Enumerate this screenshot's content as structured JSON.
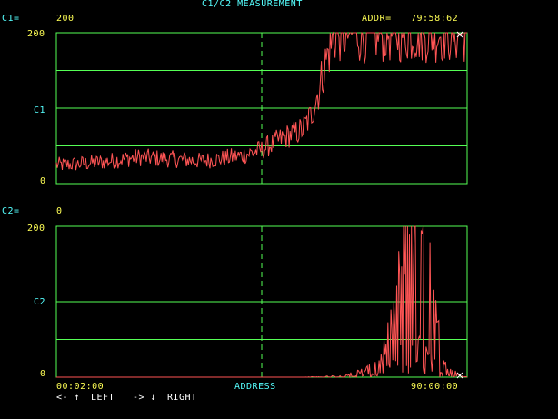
{
  "header": {
    "title": "C1/C2 MEASUREMENT"
  },
  "readouts": {
    "c1_label": "C1=",
    "c1_value": "200",
    "c2_label": "C2=",
    "c2_value": "0",
    "addr_label": "ADDR=",
    "addr_value": "79:58:62"
  },
  "upper_plot": {
    "ymax": "200",
    "ymid": "C1",
    "ymin": "0"
  },
  "lower_plot": {
    "ymax": "200",
    "ymid": "C2",
    "ymin": "0"
  },
  "x_axis": {
    "start": "00:02:00",
    "label": "ADDRESS",
    "end": "90:00:00"
  },
  "help": {
    "left_keys": "<- ↑",
    "left_label": "LEFT",
    "right_keys": "-> ↓",
    "right_label": "RIGHT"
  },
  "colors": {
    "grid": "#55ff55",
    "trace": "#ff5555",
    "label": "#55ffff",
    "value": "#ffff55"
  },
  "chart_data": [
    {
      "type": "line",
      "ylabel": "C1",
      "xlabel": "ADDRESS",
      "x_range": [
        "00:02:00",
        "90:00:00"
      ],
      "ylim": [
        0,
        200
      ],
      "cursor_x": "79:58:62",
      "series": [
        {
          "x_fraction": [
            0.02,
            0.1,
            0.2,
            0.3,
            0.35,
            0.4,
            0.45,
            0.5,
            0.55,
            0.58,
            0.6,
            0.62,
            0.63,
            0.64,
            0.65,
            0.66,
            0.67,
            0.68,
            0.7,
            0.75,
            1.0
          ],
          "values": [
            25,
            28,
            35,
            32,
            30,
            33,
            37,
            45,
            60,
            67,
            72,
            90,
            110,
            125,
            150,
            170,
            185,
            200,
            200,
            200,
            200
          ]
        }
      ]
    },
    {
      "type": "line",
      "ylabel": "C2",
      "xlabel": "ADDRESS",
      "x_range": [
        "00:02:00",
        "90:00:00"
      ],
      "ylim": [
        0,
        200
      ],
      "cursor_x": "79:58:62",
      "series": [
        {
          "x_fraction": [
            0.0,
            0.6,
            0.7,
            0.75,
            0.78,
            0.8,
            0.82,
            0.84,
            0.86,
            0.88,
            0.9,
            0.92,
            0.94,
            0.96,
            0.98,
            1.0
          ],
          "values": [
            0,
            0,
            2,
            10,
            20,
            40,
            80,
            150,
            200,
            200,
            170,
            90,
            30,
            10,
            4,
            0
          ]
        }
      ]
    }
  ]
}
